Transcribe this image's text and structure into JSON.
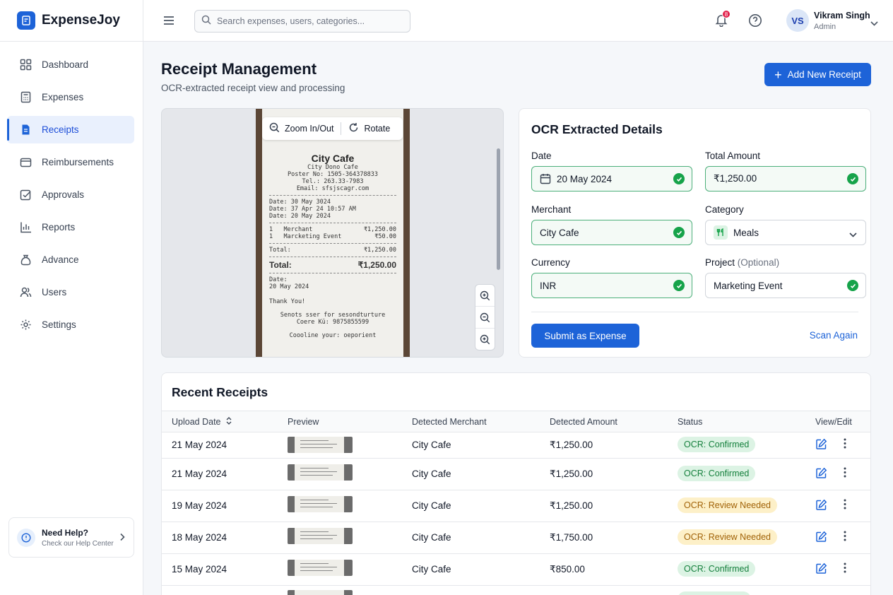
{
  "app": {
    "name": "ExpenseJoy"
  },
  "sidebar": {
    "items": [
      {
        "label": "Dashboard",
        "icon": "grid-icon"
      },
      {
        "label": "Expenses",
        "icon": "calculator-icon"
      },
      {
        "label": "Receipts",
        "icon": "document-icon",
        "active": true
      },
      {
        "label": "Reimbursements",
        "icon": "wallet-icon"
      },
      {
        "label": "Approvals",
        "icon": "checkbox-icon"
      },
      {
        "label": "Reports",
        "icon": "bar-chart-icon"
      },
      {
        "label": "Advance",
        "icon": "money-bag-icon"
      },
      {
        "label": "Users",
        "icon": "users-icon"
      },
      {
        "label": "Settings",
        "icon": "gear-icon"
      }
    ],
    "help": {
      "title": "Need Help?",
      "subtitle": "Check our Help Center"
    }
  },
  "topbar": {
    "search_placeholder": "Search expenses, users, categories...",
    "notification_count": "8",
    "user": {
      "initials": "VS",
      "name": "Vikram Singh",
      "role": "Admin"
    }
  },
  "page": {
    "title": "Receipt Management",
    "subtitle": "OCR-extracted receipt view and processing",
    "add_button": "Add New Receipt"
  },
  "viewer": {
    "zoom_label": "Zoom In/Out",
    "rotate_label": "Rotate",
    "receipt": {
      "title": "City Cafe",
      "header_lines": [
        "City Dono Cafe",
        "Poster No: 1505-364378833",
        "Tel.: 263.33-7983",
        "Email: sfsjscagr.com"
      ],
      "date_lines": [
        "Date: 30 May 3024",
        "Date: 37 Apr 24 10:57 AM",
        "Date: 20 May 2024"
      ],
      "items": [
        {
          "qty": "1",
          "name": "Merchant",
          "amount": "₹1,250.00"
        },
        {
          "qty": "1",
          "name": "Marcketing Event",
          "amount": "₹50.00"
        }
      ],
      "subtotal_label": "Total:",
      "subtotal_value": "₹1,250.00",
      "total_label": "Total:",
      "total_value": "₹1,250.00",
      "footer_date_label": "Date:",
      "footer_date": "20 May 2024",
      "thanks": "Thank You!",
      "footer_lines": [
        "Senots sser for sesondturture",
        "Coere Kü: 9875855599"
      ],
      "closing": "Coooline your: oeporient"
    }
  },
  "ocr": {
    "title": "OCR Extracted Details",
    "fields": {
      "date": {
        "label": "Date",
        "value": "20 May 2024"
      },
      "total": {
        "label": "Total Amount",
        "value": "₹1,250.00"
      },
      "merchant": {
        "label": "Merchant",
        "value": "City Cafe"
      },
      "category": {
        "label": "Category",
        "value": "Meals"
      },
      "currency": {
        "label": "Currency",
        "value": "INR"
      },
      "project": {
        "label": "Project",
        "optional": "(Optional)",
        "value": "Marketing Event"
      }
    },
    "submit_label": "Submit as Expense",
    "scan_again_label": "Scan Again"
  },
  "recent": {
    "title": "Recent Receipts",
    "columns": [
      "Upload Date",
      "Preview",
      "Detected Merchant",
      "Detected Amount",
      "Status",
      "View/Edit"
    ],
    "rows": [
      {
        "date": "21 May 2024",
        "merchant": "City Cafe",
        "amount": "₹1,250.00",
        "status": "OCR: Confirmed",
        "status_type": "ok"
      },
      {
        "date": "21 May 2024",
        "merchant": "City Cafe",
        "amount": "₹1,250.00",
        "status": "OCR: Confirmed",
        "status_type": "ok"
      },
      {
        "date": "19 May 2024",
        "merchant": "City Cafe",
        "amount": "₹1,250.00",
        "status": "OCR: Review Needed",
        "status_type": "warn"
      },
      {
        "date": "18 May 2024",
        "merchant": "City Cafe",
        "amount": "₹1,750.00",
        "status": "OCR: Review Needed",
        "status_type": "warn"
      },
      {
        "date": "15 May 2024",
        "merchant": "City Cafe",
        "amount": "₹850.00",
        "status": "OCR: Confirmed",
        "status_type": "ok"
      }
    ]
  },
  "colors": {
    "primary": "#1d63d8",
    "success": "#16a34a",
    "warning_bg": "#fdf0c8",
    "success_bg": "#dcf3e4"
  }
}
